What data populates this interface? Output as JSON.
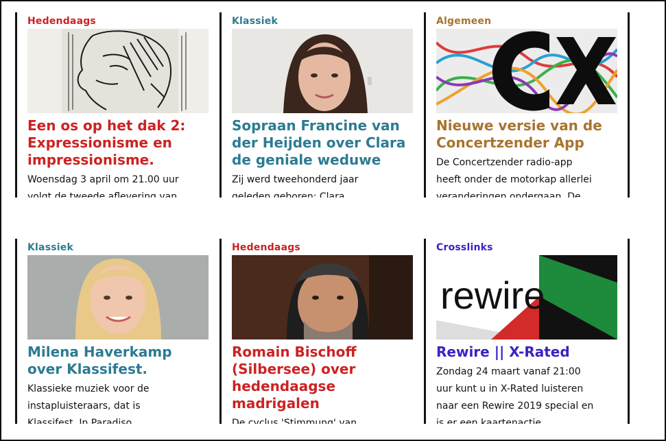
{
  "colors": {
    "red": "#cc2222",
    "teal": "#2c7b93",
    "brown": "#a8742f",
    "purple": "#3a22c4"
  },
  "cards": [
    {
      "category": "Hedendaags",
      "title": "Een os op het dak 2: Expressionisme en impressionisme.",
      "excerpt_l1": "Woensdag 3 april om 21.00 uur",
      "excerpt_l2": "volgt de tweede aflevering van...",
      "image": "expressionist-portrait-sketch"
    },
    {
      "category": "Klassiek",
      "title": "Sopraan Francine van der Heijden over Clara de geniale weduwe",
      "excerpt_l1": "Zij werd tweehonderd jaar",
      "excerpt_l2": "geleden geboren: Clara...",
      "image": "portrait-woman-dark-hair"
    },
    {
      "category": "Algemeen",
      "title": "Nieuwe versie van de Concertzender App",
      "excerpt_l1": "De Concertzender radio-app",
      "excerpt_l2": "heeft onder de motorkap allerlei",
      "excerpt_l3": "veranderingen ondergaan. De...",
      "image": "concertzender-logo"
    },
    {
      "category": "Klassiek",
      "title": "Milena Haverkamp over Klassifest.",
      "excerpt_l1": "Klassieke muziek voor de",
      "excerpt_l2": "instapluisteraars, dat is",
      "excerpt_l3": "Klassifest. In Paradiso...",
      "image": "portrait-woman-blonde"
    },
    {
      "category": "Hedendaags",
      "title": "Romain Bischoff (Silbersee) over hedendaagse madrigalen",
      "excerpt_l1": "De cyclus 'Stimmung' van...",
      "image": "portrait-man-grey-hair"
    },
    {
      "category": "Crosslinks",
      "title": "Rewire || X-Rated",
      "excerpt_l1": "Zondag 24 maart vanaf 21:00",
      "excerpt_l2": "uur kunt u in X-Rated luisteren",
      "excerpt_l3": "naar een Rewire 2019 special en",
      "excerpt_l4": "is er een kaartenactie. ...",
      "logo_text": "rewire",
      "image": "rewire-logo"
    }
  ]
}
